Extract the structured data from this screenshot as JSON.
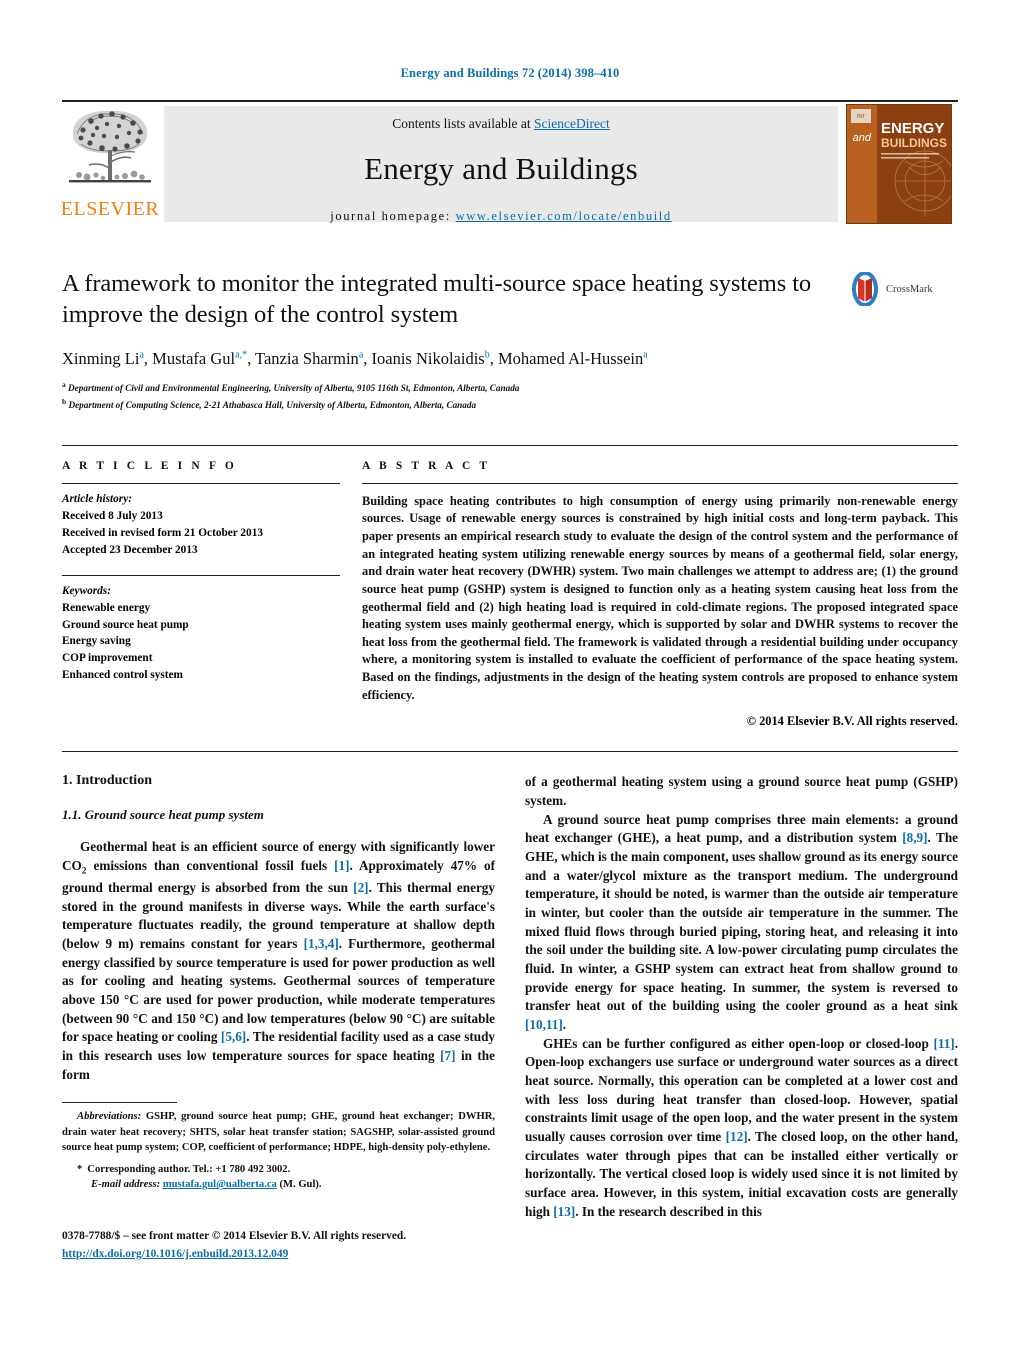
{
  "running_head": "Energy and Buildings 72 (2014) 398–410",
  "masthead": {
    "publisher_name": "ELSEVIER",
    "contents_prefix": "Contents lists available at ",
    "contents_link": "ScienceDirect",
    "journal_name": "Energy and Buildings",
    "homepage_label": "journal homepage:",
    "homepage_url": "www.elsevier.com/locate/enbuild",
    "cover": {
      "line_and": "and",
      "line_energy": "ENERGY",
      "line_buildings": "BUILDINGS",
      "corner_tag": "INT"
    }
  },
  "article": {
    "title": "A framework to monitor the integrated multi-source space heating systems to improve the design of the control system",
    "crossmark_label": "CrossMark",
    "authors": [
      {
        "name": "Xinming Li",
        "marks": "a"
      },
      {
        "name": "Mustafa Gul",
        "marks": "a,*"
      },
      {
        "name": "Tanzia Sharmin",
        "marks": "a"
      },
      {
        "name": "Ioanis Nikolaidis",
        "marks": "b"
      },
      {
        "name": "Mohamed Al-Hussein",
        "marks": "a"
      }
    ],
    "affiliations": [
      {
        "mark": "a",
        "text": "Department of Civil and Environmental Engineering, University of Alberta, 9105 116th St, Edmonton, Alberta, Canada"
      },
      {
        "mark": "b",
        "text": "Department of Computing Science, 2-21 Athabasca Hall, University of Alberta, Edmonton, Alberta, Canada"
      }
    ]
  },
  "article_info": {
    "heading": "A R T I C L E    I N F O",
    "history_label": "Article history:",
    "history": [
      "Received 8 July 2013",
      "Received in revised form 21 October 2013",
      "Accepted 23 December 2013"
    ],
    "keywords_label": "Keywords:",
    "keywords": [
      "Renewable energy",
      "Ground source heat pump",
      "Energy saving",
      "COP improvement",
      "Enhanced control system"
    ]
  },
  "abstract": {
    "heading": "A B S T R A C T",
    "text": "Building space heating contributes to high consumption of energy using primarily non-renewable energy sources. Usage of renewable energy sources is constrained by high initial costs and long-term payback. This paper presents an empirical research study to evaluate the design of the control system and the performance of an integrated heating system utilizing renewable energy sources by means of a geothermal field, solar energy, and drain water heat recovery (DWHR) system. Two main challenges we attempt to address are; (1) the ground source heat pump (GSHP) system is designed to function only as a heating system causing heat loss from the geothermal field and (2) high heating load is required in cold-climate regions. The proposed integrated space heating system uses mainly geothermal energy, which is supported by solar and DWHR systems to recover the heat loss from the geothermal field. The framework is validated through a residential building under occupancy where, a monitoring system is installed to evaluate the coefficient of performance of the space heating system. Based on the findings, adjustments in the design of the heating system controls are proposed to enhance system efficiency.",
    "copyright": "© 2014 Elsevier B.V. All rights reserved."
  },
  "body": {
    "section_number_title": "1.  Introduction",
    "subsection_number_title": "1.1.  Ground source heat pump system",
    "left_paragraphs": [
      {
        "parts": [
          {
            "t": "Geothermal heat is an efficient source of energy with significantly lower CO"
          },
          {
            "t": "2",
            "style": "sub"
          },
          {
            "t": " emissions than conventional fossil fuels "
          },
          {
            "t": "[1]",
            "style": "ref"
          },
          {
            "t": ". Approximately 47% of ground thermal energy is absorbed from the sun "
          },
          {
            "t": "[2]",
            "style": "ref"
          },
          {
            "t": ". This thermal energy stored in the ground manifests in diverse ways. While the earth surface's temperature fluctuates readily, the ground temperature at shallow depth (below 9 m) remains constant for years "
          },
          {
            "t": "[1,3,4]",
            "style": "ref"
          },
          {
            "t": ". Furthermore, geothermal energy classified by source temperature is used for power production as well as for cooling and heating systems. Geothermal sources of temperature above 150 °C are used for power production, while moderate temperatures (between 90 °C and 150 °C) and low temperatures (below 90 °C) are suitable for space heating or cooling "
          },
          {
            "t": "[5,6]",
            "style": "ref"
          },
          {
            "t": ". The residential facility used as a case study in this research uses low temperature sources for space heating "
          },
          {
            "t": "[7]",
            "style": "ref"
          },
          {
            "t": " in the form"
          }
        ]
      }
    ],
    "right_paragraphs": [
      {
        "indent": false,
        "parts": [
          {
            "t": "of a geothermal heating system using a ground source heat pump (GSHP) system."
          }
        ]
      },
      {
        "indent": true,
        "parts": [
          {
            "t": "A ground source heat pump comprises three main elements: a ground heat exchanger (GHE), a heat pump, and a distribution system "
          },
          {
            "t": "[8,9]",
            "style": "ref"
          },
          {
            "t": ". The GHE, which is the main component, uses shallow ground as its energy source and a water/glycol mixture as the transport medium. The underground temperature, it should be noted, is warmer than the outside air temperature in winter, but cooler than the outside air temperature in the summer. The mixed fluid flows through buried piping, storing heat, and releasing it into the soil under the building site. A low-power circulating pump circulates the fluid. In winter, a GSHP system can extract heat from shallow ground to provide energy for space heating. In summer, the system is reversed to transfer heat out of the building using the cooler ground as a heat sink "
          },
          {
            "t": "[10,11]",
            "style": "ref"
          },
          {
            "t": "."
          }
        ]
      },
      {
        "indent": true,
        "parts": [
          {
            "t": "GHEs can be further configured as either open-loop or closed-loop "
          },
          {
            "t": "[11]",
            "style": "ref"
          },
          {
            "t": ". Open-loop exchangers use surface or underground water sources as a direct heat source. Normally, this operation can be completed at a lower cost and with less loss during heat transfer than closed-loop. However, spatial constraints limit usage of the open loop, and the water present in the system usually causes corrosion over time "
          },
          {
            "t": "[12]",
            "style": "ref"
          },
          {
            "t": ". The closed loop, on the other hand, circulates water through pipes that can be installed either vertically or horizontally. The vertical closed loop is widely used since it is not limited by surface area. However, in this system, initial excavation costs are generally high "
          },
          {
            "t": "[13]",
            "style": "ref"
          },
          {
            "t": ". In the research described in this"
          }
        ]
      }
    ]
  },
  "footnotes": {
    "abbreviations_label": "Abbreviations:",
    "abbreviations_text": " GSHP, ground source heat pump; GHE, ground heat exchanger; DWHR, drain water heat recovery; SHTS, solar heat transfer station; SAGSHP, solar-assisted ground source heat pump system; COP, coefficient of performance; HDPE, high-density poly-ethylene.",
    "corresponding_star": "*",
    "corresponding_text": "Corresponding author. Tel.: +1 780 492 3002.",
    "email_label": "E-mail address:",
    "email": "mustafa.gul@ualberta.ca",
    "email_suffix": " (M. Gul)."
  },
  "footer": {
    "issn_line": "0378-7788/$ – see front matter © 2014 Elsevier B.V. All rights reserved.",
    "doi": "http://dx.doi.org/10.1016/j.enbuild.2013.12.049"
  },
  "colors": {
    "link": "#0b6ea8",
    "elsevier_orange": "#f07f13",
    "cover_brown": "#8a3d12",
    "crossmark_blue": "#2b7fc4",
    "crossmark_red": "#d4352a"
  }
}
